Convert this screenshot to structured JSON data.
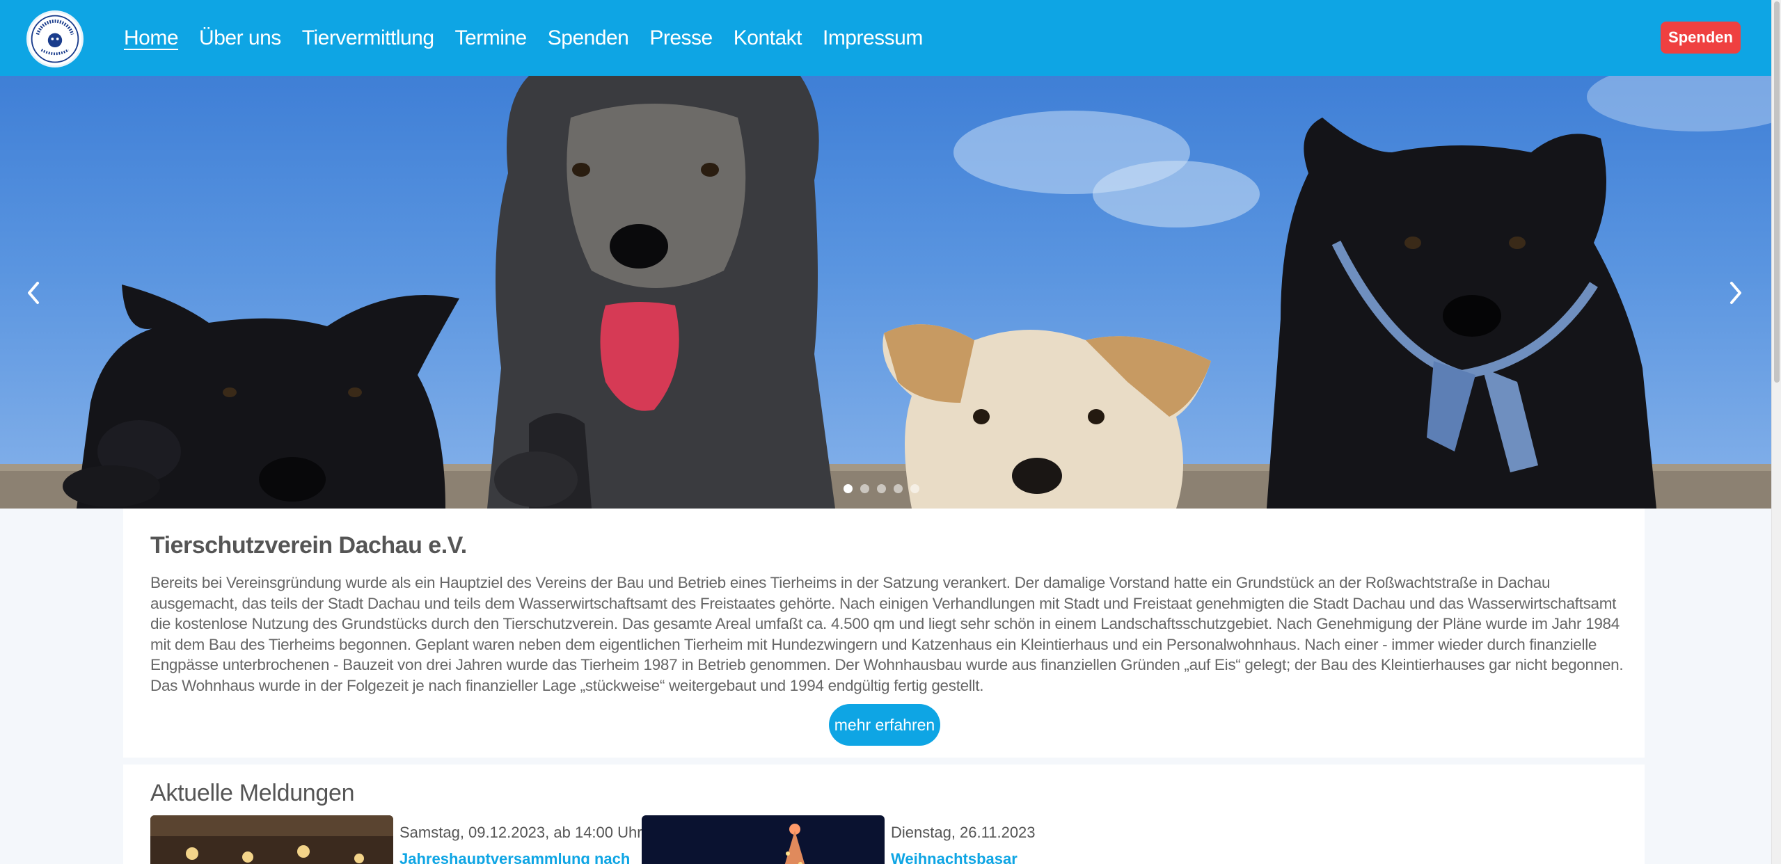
{
  "header": {
    "logo_text": "Tierschutzverein Dachau e.V.",
    "nav": [
      {
        "label": "Home",
        "active": true
      },
      {
        "label": "Über uns"
      },
      {
        "label": "Tiervermittlung"
      },
      {
        "label": "Termine"
      },
      {
        "label": "Spenden"
      },
      {
        "label": "Presse"
      },
      {
        "label": "Kontakt"
      },
      {
        "label": "Impressum"
      }
    ],
    "donate_label": "Spenden"
  },
  "carousel": {
    "slide_count": 5,
    "active_slide": 1,
    "prev_icon": "chevron-left-icon",
    "next_icon": "chevron-right-icon"
  },
  "about": {
    "title": "Tierschutzverein Dachau e.V.",
    "text": "Bereits bei Vereinsgründung wurde als ein Hauptziel des Vereins der Bau und Betrieb eines Tierheims in der Satzung verankert. Der damalige Vorstand hatte ein Grundstück an der Roßwachtstraße in Dachau ausgemacht, das teils der Stadt Dachau und teils dem Wasserwirtschaftsamt des Freistaates gehörte. Nach einigen Verhandlungen mit Stadt und Freistaat genehmigten die Stadt Dachau und das Wasserwirtschaftsamt die kostenlose Nutzung des Grundstücks durch den Tierschutzverein. Das gesamte Areal umfaßt ca. 4.500 qm und liegt sehr schön in einem Landschaftsschutzgebiet. Nach Genehmigung der Pläne wurde im Jahr 1984 mit dem Bau des Tierheims begonnen. Geplant waren neben dem eigentlichen Tierheim mit Hundezwingern und Katzenhaus ein Kleintierhaus und ein Personalwohnhaus. Nach einer - immer wieder durch finanzielle Engpässe unterbrochenen - Bauzeit von drei Jahren wurde das Tierheim 1987 in Betrieb genommen. Der Wohnhausbau wurde aus finanziellen Gründen „auf Eis“ gelegt; der Bau des Kleintierhauses gar nicht begonnen. Das Wohnhaus wurde in der Folgezeit je nach finanzieller Lage „stückweise“ weitergebaut und 1994 endgültig fertig gestellt.",
    "button_label": "mehr erfahren"
  },
  "news": {
    "heading": "Aktuelle Meldungen",
    "items": [
      {
        "date": "Samstag, 09.12.2023, ab 14:00 Uhr",
        "title": "Jahreshauptversammlung nach"
      },
      {
        "date": "Dienstag, 26.11.2023",
        "title": "Weihnachtsbasar"
      }
    ]
  },
  "colors": {
    "primary": "#0ea5e4",
    "donate": "#ef4040",
    "background": "#f4f7fb"
  }
}
